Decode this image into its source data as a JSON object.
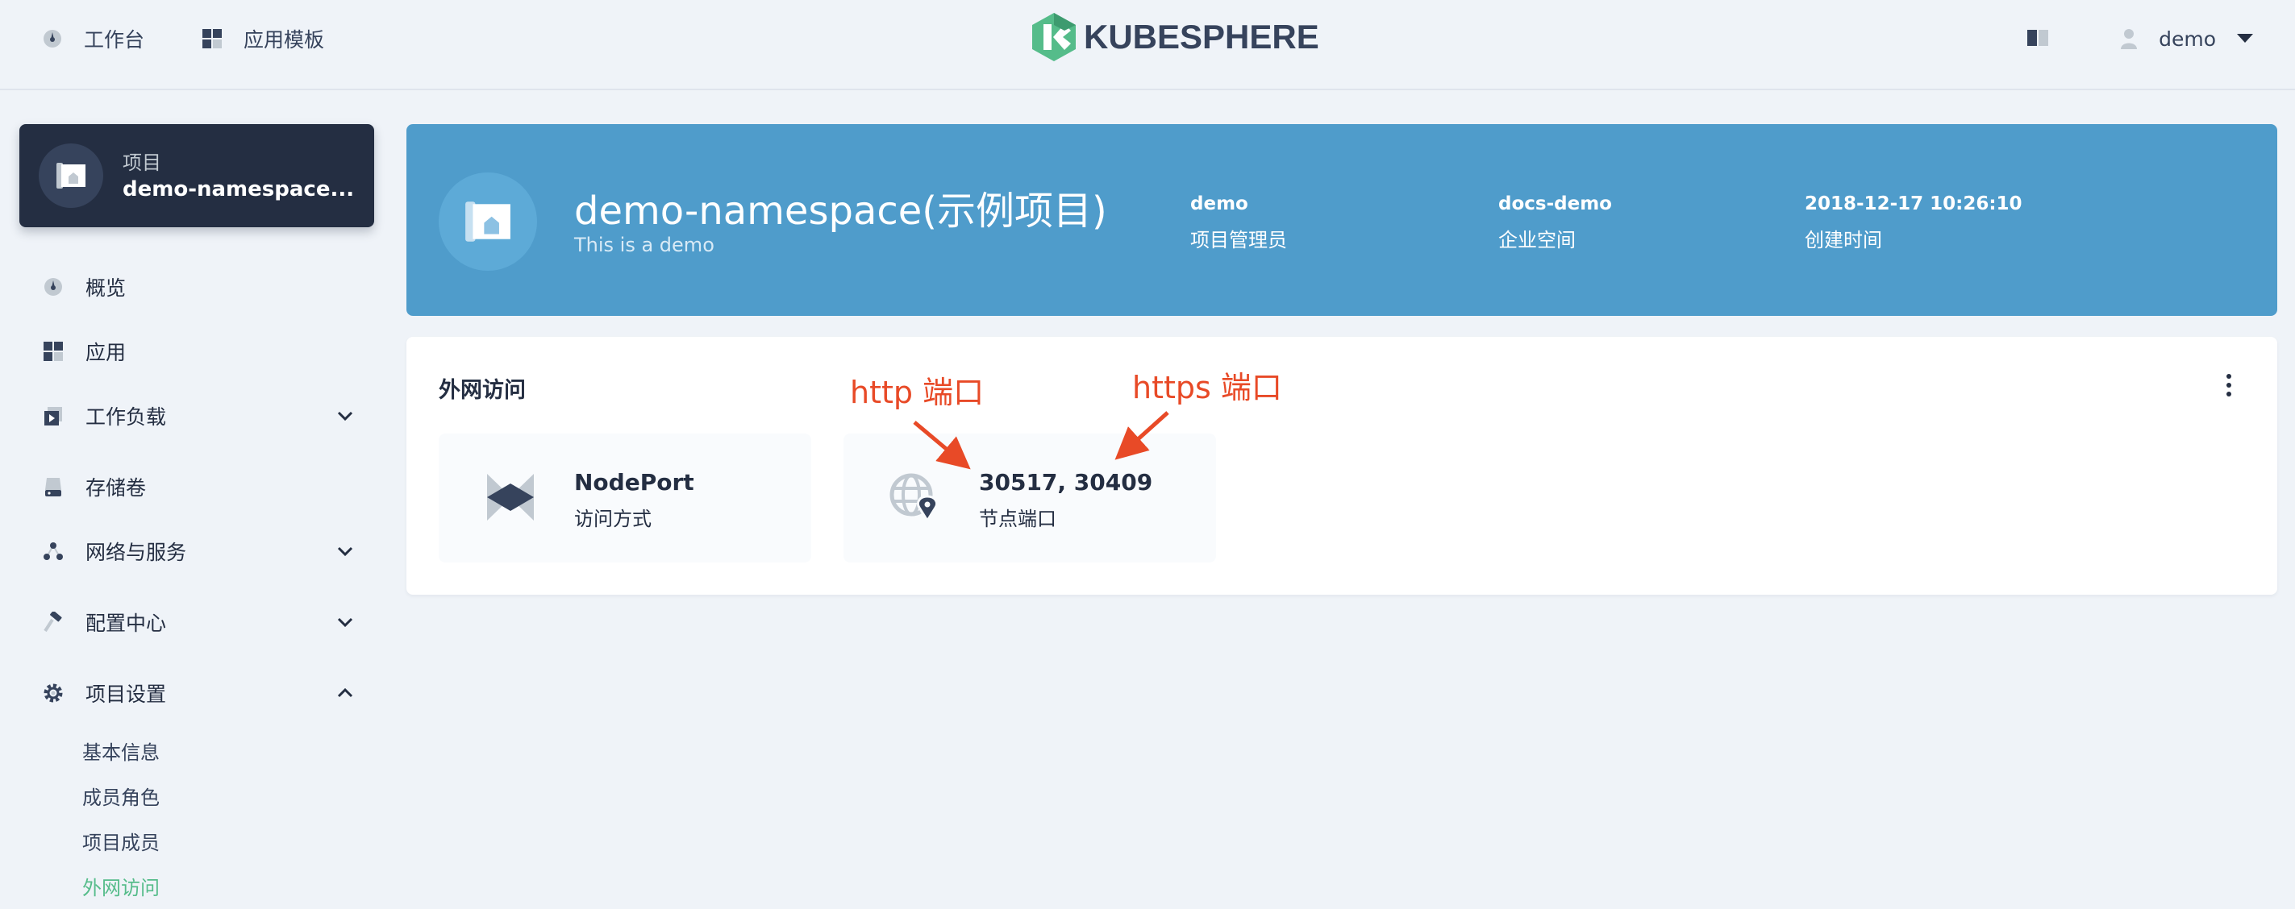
{
  "topbar": {
    "nav": [
      {
        "label": "工作台",
        "icon": "dashboard-icon"
      },
      {
        "label": "应用模板",
        "icon": "app-template-icon"
      }
    ],
    "logo_text": "KUBESPHERE",
    "user_name": "demo"
  },
  "sidebar": {
    "project_label": "项目",
    "project_name": "demo-namespace...",
    "items": [
      {
        "label": "概览",
        "icon": "dashboard-icon"
      },
      {
        "label": "应用",
        "icon": "apps-icon"
      },
      {
        "label": "工作负载",
        "icon": "workload-icon"
      },
      {
        "label": "存储卷",
        "icon": "storage-icon"
      },
      {
        "label": "网络与服务",
        "icon": "network-icon"
      },
      {
        "label": "配置中心",
        "icon": "hammer-icon"
      },
      {
        "label": "项目设置",
        "icon": "gear-icon"
      }
    ],
    "sub_items": [
      "基本信息",
      "成员角色",
      "项目成员",
      "外网访问"
    ],
    "active_sub": "外网访问"
  },
  "banner": {
    "title": "demo-namespace(示例项目)",
    "description": "This is a demo",
    "meta": [
      {
        "value": "demo",
        "key": "项目管理员"
      },
      {
        "value": "docs-demo",
        "key": "企业空间"
      },
      {
        "value": "2018-12-17 10:26:10",
        "key": "创建时间"
      }
    ]
  },
  "access": {
    "title": "外网访问",
    "tiles": [
      {
        "value": "NodePort",
        "label": "访问方式",
        "icon": "nodeport-icon"
      },
      {
        "value": "30517, 30409",
        "label": "节点端口",
        "icon": "globe-pin-icon"
      }
    ]
  },
  "annotations": {
    "http": "http 端口",
    "https": "https 端口"
  },
  "colors": {
    "banner": "#4f9ccb",
    "sidebar_card": "#242e42",
    "active_green": "#55bc8a",
    "annotation_red": "#e84a27"
  }
}
